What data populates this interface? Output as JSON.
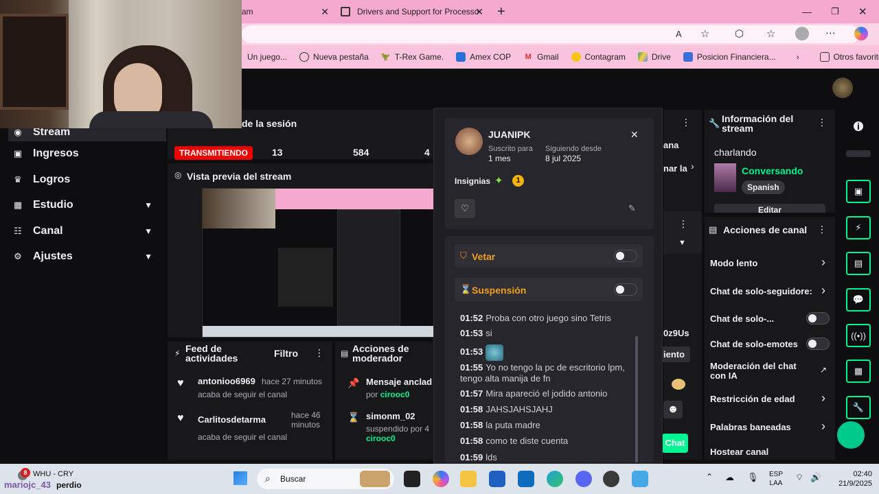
{
  "browser": {
    "tabs": [
      {
        "label": "am"
      },
      {
        "label": "Drivers and Support for Processo"
      }
    ],
    "bookmarks": [
      "Un juego...",
      "Nueva pestaña",
      "T-Rex Game.",
      "Amex COP",
      "Gmail",
      "Contagram",
      "Drive",
      "Posicion Financiera..."
    ],
    "other_bookmarks": "Otros favoritos"
  },
  "sidebar": {
    "items": [
      {
        "label": "Stream",
        "icon": "stream-icon"
      },
      {
        "label": "Ingresos",
        "icon": "revenue-icon"
      },
      {
        "label": "Logros",
        "icon": "trophy-icon"
      },
      {
        "label": "Estudio",
        "icon": "studio-icon"
      },
      {
        "label": "Canal",
        "icon": "channel-icon"
      },
      {
        "label": "Ajustes",
        "icon": "gear-icon"
      }
    ]
  },
  "session": {
    "title": "de la sesión",
    "live_badge": "TRANSMITIENDO",
    "stats": [
      "13",
      "584",
      "4"
    ]
  },
  "preview": {
    "title": "Vista previa del stream"
  },
  "activity_feed": {
    "title": "Feed de actividades",
    "filter": "Filtro",
    "items": [
      {
        "user": "antonioo6969",
        "time": "hace 27 minutos",
        "action": "acaba de seguir el canal"
      },
      {
        "user": "Carlitosdetarma",
        "time": "hace 46 minutos",
        "action": "acaba de seguir el canal"
      }
    ]
  },
  "mod_actions": {
    "title": "Acciones de moderador",
    "items": [
      {
        "title": "Mensaje anclad",
        "sub": "por",
        "by": "cirooc0"
      },
      {
        "title": "simonm_02",
        "sub": "suspendido por 4",
        "by": "cirooc0"
      }
    ]
  },
  "usercard": {
    "username": "JUANIPK",
    "sub_label": "Suscrito para",
    "sub_value": "1 mes",
    "follow_label": "Siguiendo desde",
    "follow_value": "8 jul 2025",
    "badges_label": "Insignias",
    "badge_count": "1",
    "veto": "Vetar",
    "suspension": "Suspensión",
    "chat": [
      {
        "time": "01:52",
        "text": "Proba con otro juego sino Tetris"
      },
      {
        "time": "01:53",
        "text": "si"
      },
      {
        "time": "01:53",
        "text": ""
      },
      {
        "time": "01:55",
        "text": "Yo no tengo la pc de escritorio lpm, tengo alta manija de fn"
      },
      {
        "time": "01:57",
        "text": "Mira apareció el jodido antonio"
      },
      {
        "time": "01:58",
        "text": "JAHSJAHSJAHJ"
      },
      {
        "time": "01:58",
        "text": "la puta madre"
      },
      {
        "time": "01:58",
        "text": "como te diste cuenta"
      },
      {
        "time": "01:59",
        "text": "lds"
      }
    ]
  },
  "behind": {
    "ana": "ana",
    "nar_la": "nar la",
    "oz9us": "0z9Us",
    "iento": "iento",
    "chat": "Chat"
  },
  "stream_info": {
    "title": "Información del stream",
    "stream_title": "charlando",
    "category": "Conversando",
    "language": "Spanish",
    "edit": "Editar"
  },
  "channel_actions": {
    "title": "Acciones de canal",
    "items": [
      {
        "label": "Modo lento",
        "control": "chevron"
      },
      {
        "label": "Chat de solo-seguidore:",
        "control": "chevron"
      },
      {
        "label": "Chat de solo-...",
        "control": "toggle"
      },
      {
        "label": "Chat de solo-emotes",
        "control": "toggle"
      },
      {
        "label": "Moderación del chat con IA",
        "control": "external"
      },
      {
        "label": "Restricción de edad",
        "control": "chevron"
      },
      {
        "label": "Palabras baneadas",
        "control": "chevron"
      },
      {
        "label": "Hostear canal",
        "control": "none"
      }
    ]
  },
  "taskbar": {
    "music_title": "WHU - CRY",
    "music_sub": "perdio",
    "overlay_user": "mariojc_43",
    "notif_count": "8",
    "search": "Buscar",
    "lang1": "ESP",
    "lang2": "LAA",
    "time": "02:40",
    "date": "21/9/2025"
  },
  "colors": {
    "accent": "#00f593",
    "live": "#eb0400",
    "tabbar": "#f6a9cf"
  }
}
